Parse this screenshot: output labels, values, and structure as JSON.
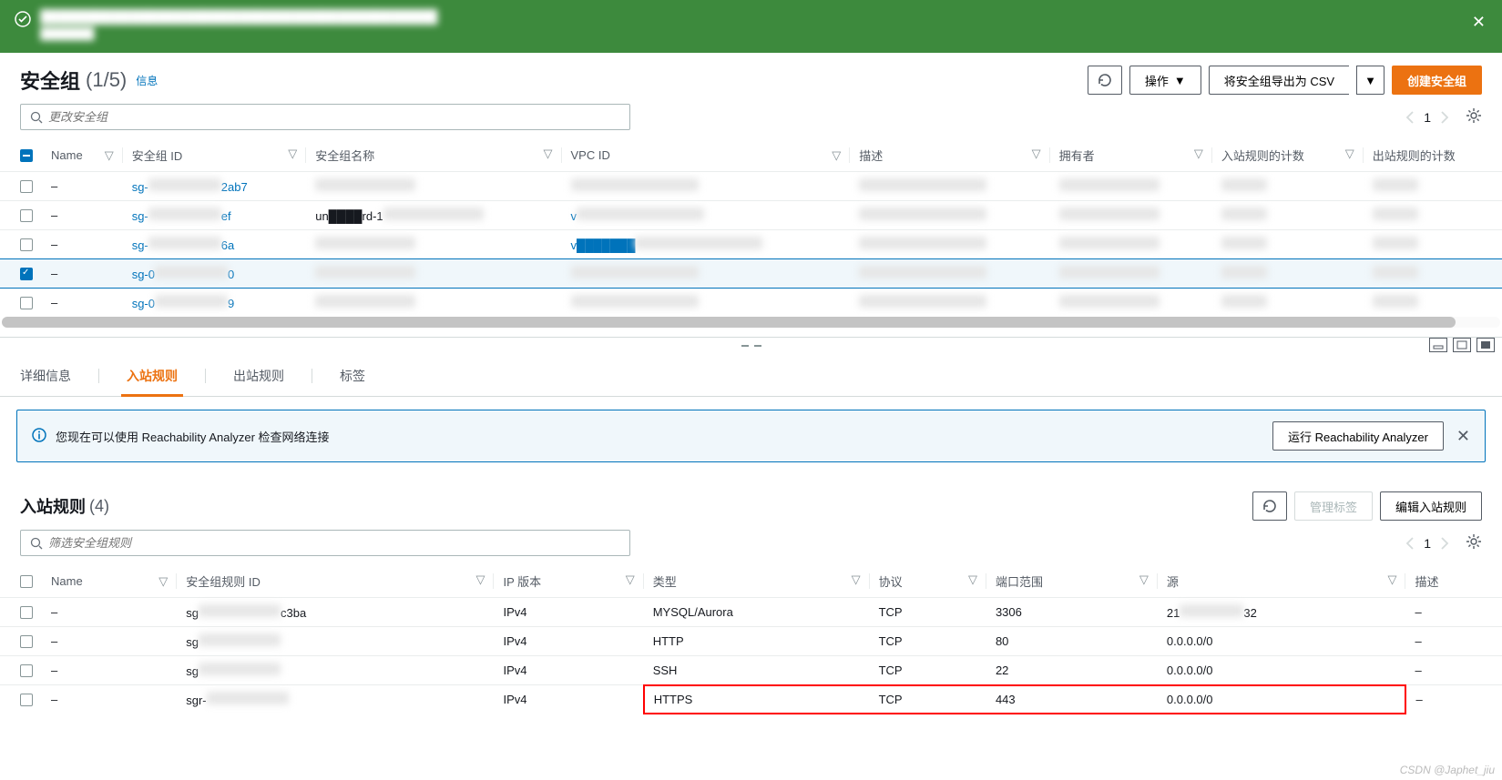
{
  "notification": {
    "line1": "████████████████████████████████████████████",
    "line2": "███████"
  },
  "header": {
    "title": "安全组",
    "count": "(1/5)",
    "info_link": "信息",
    "refresh_title": "刷新",
    "actions_label": "操作",
    "export_label": "将安全组导出为 CSV",
    "create_label": "创建安全组"
  },
  "search": {
    "placeholder": "更改安全组"
  },
  "pager": {
    "page": "1"
  },
  "sg_table": {
    "columns": [
      "Name",
      "安全组 ID",
      "安全组名称",
      "VPC ID",
      "描述",
      "拥有者",
      "入站规则的计数",
      "出站规则的计数"
    ],
    "rows": [
      {
        "selected": false,
        "name": "–",
        "id_prefix": "sg-",
        "id_suffix": "2ab7",
        "vpc_text": ""
      },
      {
        "selected": false,
        "name": "–",
        "id_prefix": "sg-",
        "id_suffix": "ef",
        "sgname_hint": "un████rd-1",
        "vpc_text": "v"
      },
      {
        "selected": false,
        "name": "–",
        "id_prefix": "sg-",
        "id_suffix": "6a",
        "vpc_text": "v███████"
      },
      {
        "selected": true,
        "name": "–",
        "id_prefix": "sg-0",
        "id_suffix": "0",
        "vpc_text": ""
      },
      {
        "selected": false,
        "name": "–",
        "id_prefix": "sg-0",
        "id_suffix": "9",
        "vpc_text": ""
      }
    ]
  },
  "tabs": {
    "items": [
      "详细信息",
      "入站规则",
      "出站规则",
      "标签"
    ],
    "active_index": 1
  },
  "info_banner": {
    "text": "您现在可以使用 Reachability Analyzer 检查网络连接",
    "run_label": "运行 Reachability Analyzer"
  },
  "rules": {
    "title": "入站规则",
    "count": "(4)",
    "manage_tags": "管理标签",
    "edit_label": "编辑入站规则",
    "search_placeholder": "筛选安全组规则",
    "page": "1",
    "columns": [
      "Name",
      "安全组规则 ID",
      "IP 版本",
      "类型",
      "协议",
      "端口范围",
      "源",
      "描述"
    ],
    "rows": [
      {
        "name": "–",
        "id_prefix": "sg",
        "id_suffix": "c3ba",
        "ip": "IPv4",
        "type": "MYSQL/Aurora",
        "proto": "TCP",
        "port": "3306",
        "source_prefix": "21",
        "source_suffix": "32",
        "desc": "–",
        "highlight": false
      },
      {
        "name": "–",
        "id_prefix": "sg",
        "id_suffix": "",
        "ip": "IPv4",
        "type": "HTTP",
        "proto": "TCP",
        "port": "80",
        "source": "0.0.0.0/0",
        "desc": "–",
        "highlight": false
      },
      {
        "name": "–",
        "id_prefix": "sg",
        "id_suffix": "",
        "ip": "IPv4",
        "type": "SSH",
        "proto": "TCP",
        "port": "22",
        "source": "0.0.0.0/0",
        "desc": "–",
        "highlight": false
      },
      {
        "name": "–",
        "id_prefix": "sgr-",
        "id_suffix": "",
        "ip": "IPv4",
        "type": "HTTPS",
        "proto": "TCP",
        "port": "443",
        "source": "0.0.0.0/0",
        "desc": "–",
        "highlight": true
      }
    ]
  },
  "watermark": "CSDN @Japhet_jiu"
}
